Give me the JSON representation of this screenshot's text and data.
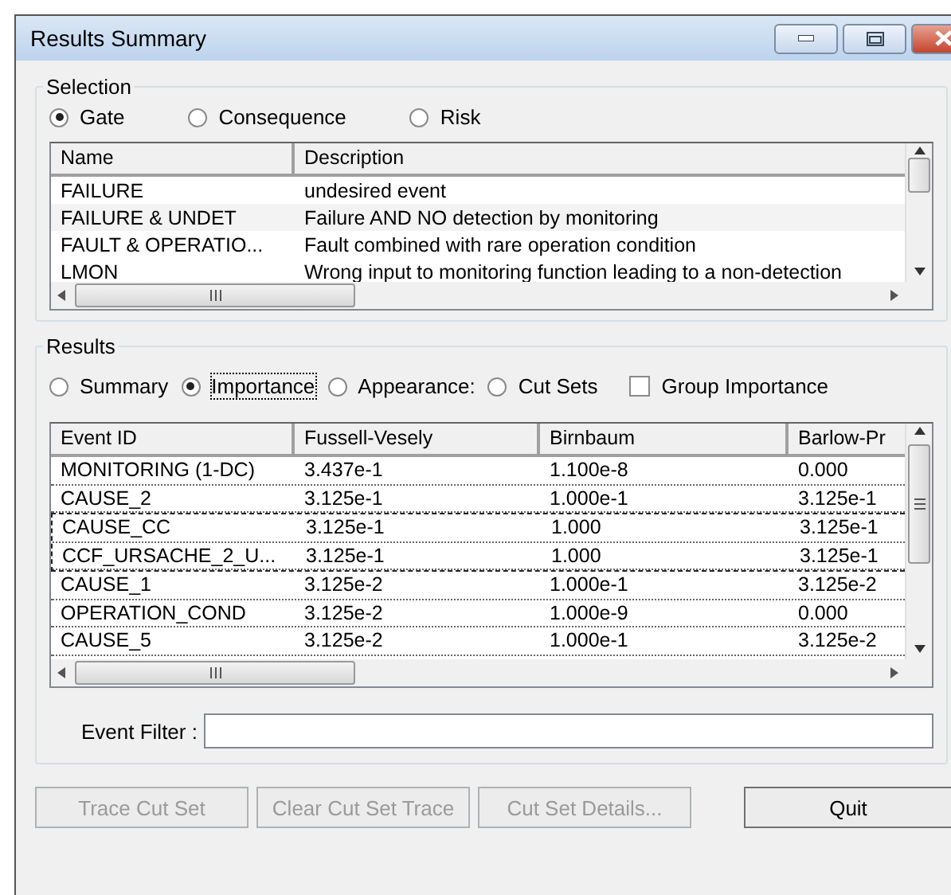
{
  "window": {
    "title": "Results Summary"
  },
  "selection": {
    "legend": "Selection",
    "options": [
      {
        "label": "Gate",
        "selected": true
      },
      {
        "label": "Consequence",
        "selected": false
      },
      {
        "label": "Risk",
        "selected": false
      }
    ],
    "list": {
      "columns": [
        "Name",
        "Description"
      ],
      "rows": [
        {
          "cells": [
            "FAILURE",
            "undesired event"
          ],
          "highlighted": false
        },
        {
          "cells": [
            "FAILURE & UNDET",
            "Failure AND NO detection by monitoring"
          ],
          "highlighted": true
        },
        {
          "cells": [
            "FAULT & OPERATIO...",
            "Fault combined with rare operation condition"
          ],
          "highlighted": false
        },
        {
          "cells": [
            "LMON",
            "Wrong input to monitoring function leading to a non-detection"
          ],
          "highlighted": false
        }
      ]
    }
  },
  "results": {
    "legend": "Results",
    "options": [
      {
        "label": "Summary",
        "selected": false
      },
      {
        "label": "Importance",
        "selected": true
      },
      {
        "label": "Appearance:",
        "selected": false
      },
      {
        "label": "Cut Sets",
        "selected": false
      }
    ],
    "group_importance": {
      "label": "Group Importance",
      "checked": false
    },
    "table": {
      "columns": [
        "Event ID",
        "Fussell-Vesely",
        "Birnbaum",
        "Barlow-Pr"
      ],
      "rows": [
        {
          "cells": [
            "MONITORING (1-DC)",
            "3.437e-1",
            "1.100e-8",
            "0.000"
          ],
          "traced": false
        },
        {
          "cells": [
            "CAUSE_2",
            "3.125e-1",
            "1.000e-1",
            "3.125e-1"
          ],
          "traced": false
        },
        {
          "cells": [
            "CAUSE_CC",
            "3.125e-1",
            "1.000",
            "3.125e-1"
          ],
          "traced": true
        },
        {
          "cells": [
            "CCF_URSACHE_2_U...",
            "3.125e-1",
            "1.000",
            "3.125e-1"
          ],
          "traced": true
        },
        {
          "cells": [
            "CAUSE_1",
            "3.125e-2",
            "1.000e-1",
            "3.125e-2"
          ],
          "traced": false
        },
        {
          "cells": [
            "OPERATION_COND",
            "3.125e-2",
            "1.000e-9",
            "0.000"
          ],
          "traced": false
        },
        {
          "cells": [
            "CAUSE_5",
            "3.125e-2",
            "1.000e-1",
            "3.125e-2"
          ],
          "traced": false
        }
      ]
    },
    "event_filter": {
      "label": "Event Filter :"
    }
  },
  "buttons": [
    {
      "label": "Trace Cut Set",
      "disabled": true
    },
    {
      "label": "Clear Cut Set Trace",
      "disabled": true
    },
    {
      "label": "Cut Set Details...",
      "disabled": true
    },
    {
      "label": "Quit",
      "disabled": false
    }
  ]
}
